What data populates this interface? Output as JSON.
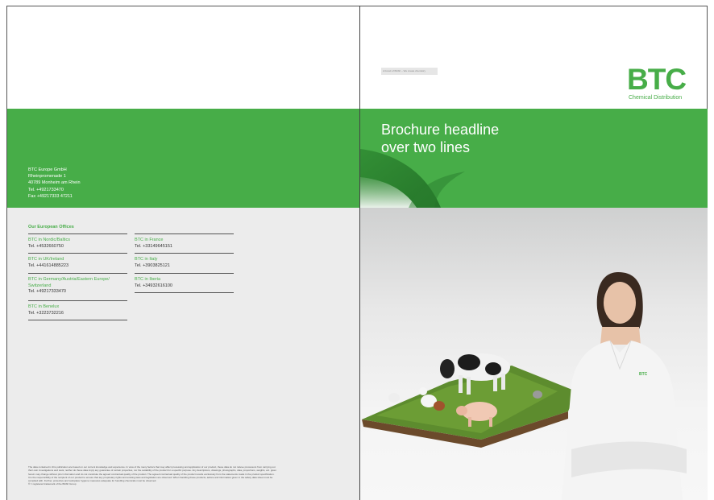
{
  "left_page": {
    "address": {
      "company": "BTC Europe GmbH",
      "street": "Rheinpromenade 1",
      "city": "40789 Monheim am Rhein",
      "tel": "Tel. +4921733470",
      "fax": "Fax +49217333 47211"
    },
    "offices_title": "Our European Offices",
    "offices": [
      {
        "name": "BTC in Nordic/Baltics",
        "tel": "Tel. +4532660750"
      },
      {
        "name": "BTC in UK/Ireland",
        "tel": "Tel. +441614885223"
      },
      {
        "name": "BTC in Germany/Austria/Eastern Europe/",
        "name2": "Switzerland",
        "tel": "Tel. +49217333470"
      },
      {
        "name": "BTC in Benelux",
        "tel": "Tel. +3223732216"
      },
      {
        "name": "BTC in France",
        "tel": "Tel. +33149645151"
      },
      {
        "name": "BTC in Italy",
        "tel": "Tel. +3903825121"
      },
      {
        "name": "BTC in Iberia",
        "tel": "Tel. +34932616100"
      }
    ],
    "disclaimer": [
      "The data contained in this publication are based on our current knowledge and experience. In view of the many factors that may affect processing and application of our product, these data do not relieve processors from carrying out",
      "their own investigations and tests; neither do these data imply any guarantee of certain properties, nor the suitability of the product for a specific purpose. Any descriptions, drawings, photographs, data, proportions, weights, etc. given",
      "herein may change without prior information and do not constitute the agreed contractual quality of the product. The agreed contractual quality of the product results exclusively from the statements made in the product specification.",
      "It is the responsibility of the recipient of our product to ensure that any proprietary rights and existing laws and legislation are observed. When handling these products, advice and information given in the safety data sheet must be",
      "complied with. Further, protective and workplace hygiene measures adequate for handling chemicals must be observed.",
      "® = registered trademark of the BASF Group"
    ]
  },
  "right_page": {
    "brand_tag": "A brand of BASF – We create chemistry",
    "logo": {
      "letters": "BTC",
      "subtitle": "Chemical Distribution"
    },
    "headline_line1": "Brochure headline",
    "headline_line2": "over two lines",
    "shirt_logo": "BTC"
  },
  "colors": {
    "brand_green": "#47ad48",
    "grey_panel": "#ececec",
    "text": "#333333"
  }
}
